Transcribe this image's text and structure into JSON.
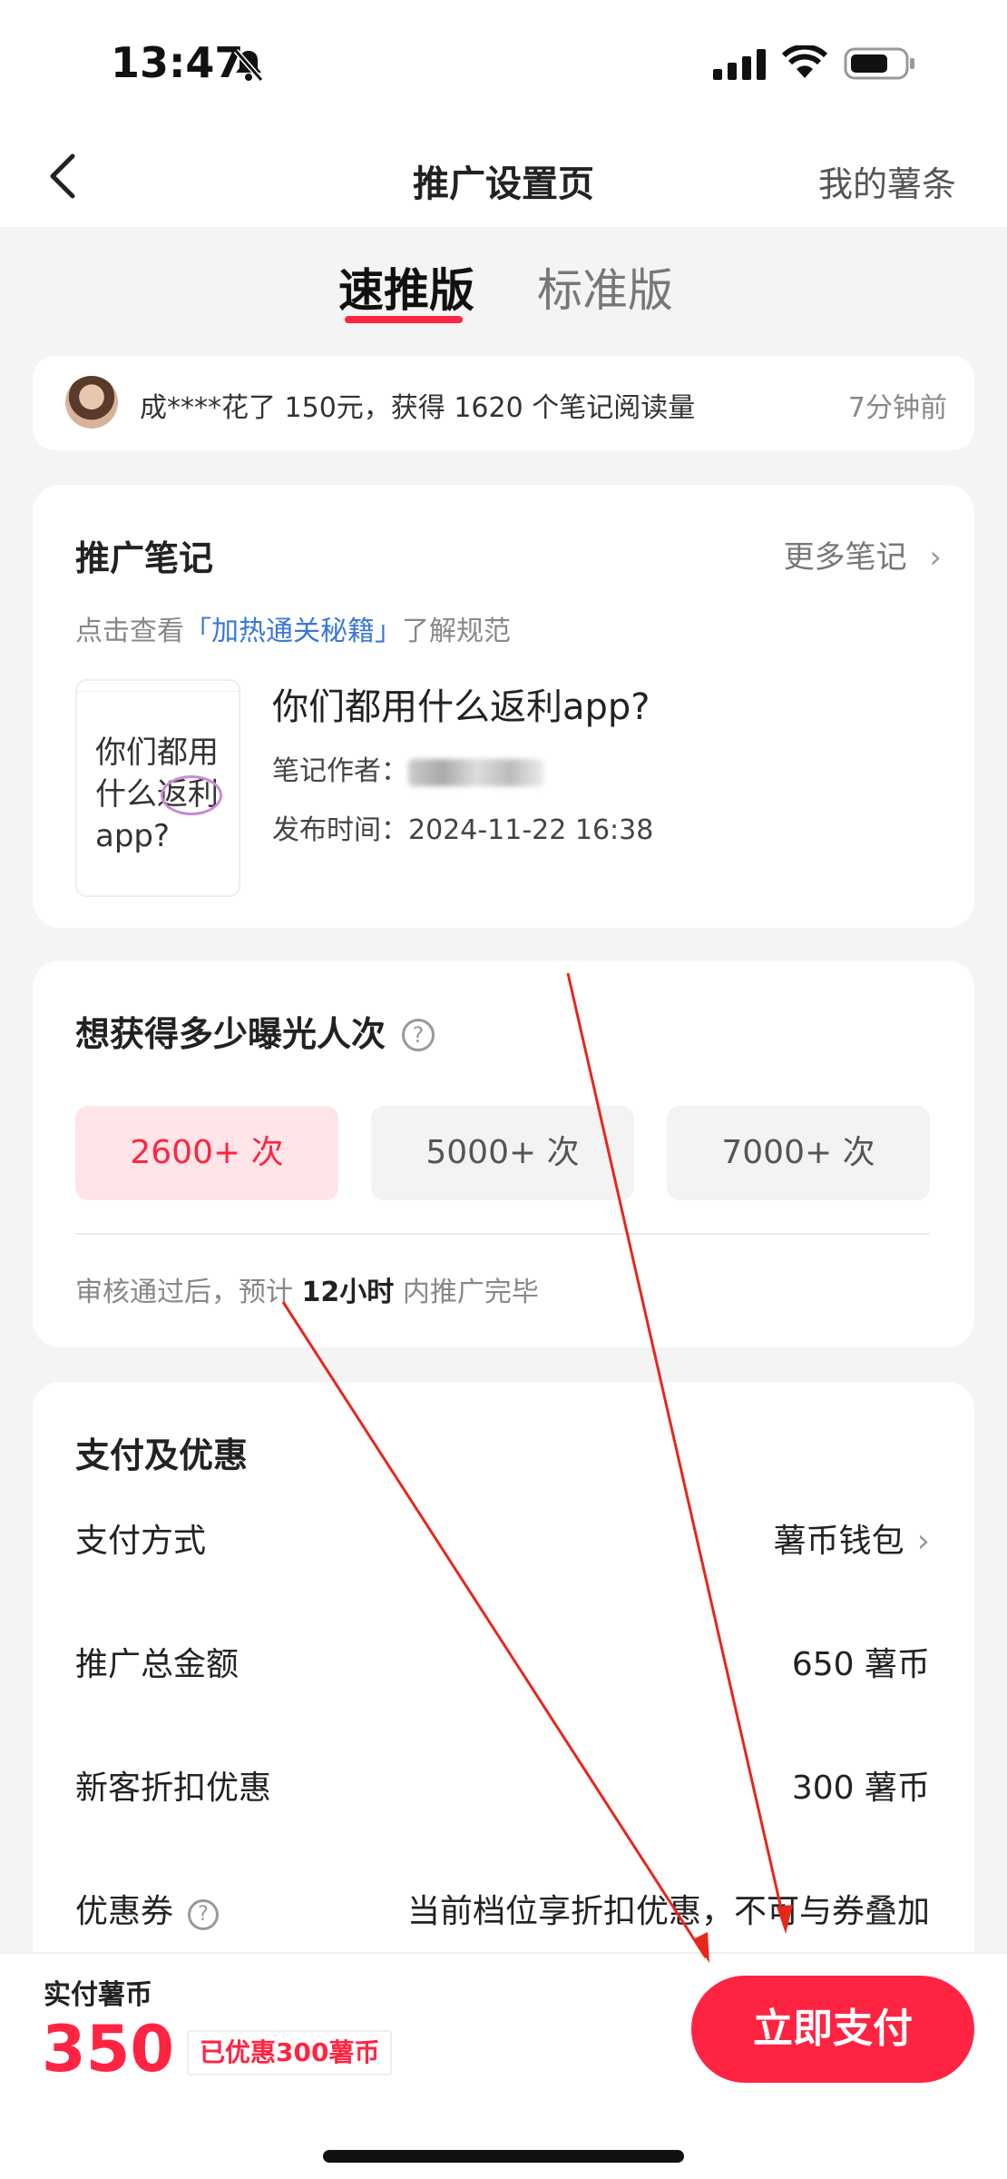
{
  "status_bar": {
    "time": "13:47"
  },
  "nav": {
    "title": "推广设置页",
    "right_link": "我的薯条"
  },
  "tabs": [
    {
      "label": "速推版",
      "active": true
    },
    {
      "label": "标准版",
      "active": false
    }
  ],
  "ticker": {
    "message": "成****花了 150元，获得 1620 个笔记阅读量",
    "time_ago": "7分钟前"
  },
  "note_card": {
    "title": "推广笔记",
    "more_link": "更多笔记",
    "hint_prefix": "点击查看",
    "hint_link": "「加热通关秘籍」",
    "hint_suffix": "了解规范",
    "thumbnail_text": "你们都用什么返利app?",
    "note_title": "你们都用什么返利app?",
    "author_label": "笔记作者：",
    "date_label": "发布时间：",
    "date_value": "2024-11-22 16:38"
  },
  "exposure": {
    "title": "想获得多少曝光人次",
    "help_symbol": "?",
    "options": [
      {
        "label": "2600+ 次",
        "selected": true
      },
      {
        "label": "5000+ 次",
        "selected": false
      },
      {
        "label": "7000+ 次",
        "selected": false
      }
    ],
    "eta_prefix": "审核通过后，预计 ",
    "eta_bold": "12小时",
    "eta_suffix": " 内推广完毕"
  },
  "payment": {
    "title": "支付及优惠",
    "rows": [
      {
        "label": "支付方式",
        "value": "薯币钱包"
      },
      {
        "label": "推广总金额",
        "value": "650 薯币"
      },
      {
        "label": "新客折扣优惠",
        "value": "300 薯币"
      },
      {
        "label": "优惠券",
        "value": "当前档位享折扣优惠，不可与券叠加"
      }
    ]
  },
  "bottom_bar": {
    "pay_label": "实付薯币",
    "amount": "350",
    "discount_badge": "已优惠300薯币",
    "pay_button": "立即支付"
  },
  "colors": {
    "accent": "#ff2442",
    "link": "#3a78d6",
    "annotation": "#e8261c"
  }
}
